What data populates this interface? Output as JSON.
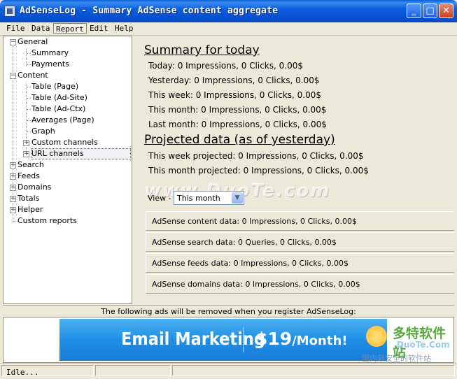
{
  "window": {
    "title": "AdSenseLog - Summary AdSense content aggregate"
  },
  "menu": [
    "File",
    "Data",
    "Report",
    "Edit",
    "Help"
  ],
  "menu_active": "Report",
  "tree": {
    "general": {
      "label": "General",
      "children": [
        "Summary",
        "Payments"
      ]
    },
    "content": {
      "label": "Content",
      "children": [
        "Table (Page)",
        "Table (Ad-Site)",
        "Table (Ad-Ctx)",
        "Averages (Page)",
        "Graph",
        "Custom channels",
        "URL channels"
      ]
    },
    "roots": [
      "Search",
      "Feeds",
      "Domains",
      "Totals",
      "Helper",
      "Custom reports"
    ],
    "selected": "URL channels"
  },
  "summary": {
    "title": "Summary for today",
    "rows": [
      "Today: 0 Impressions, 0 Clicks, 0.00$",
      "Yesterday: 0 Impressions, 0 Clicks, 0.00$",
      "This week: 0 Impressions, 0 Clicks, 0.00$",
      "This month: 0 Impressions, 0 Clicks, 0.00$",
      "Last month: 0 Impressions, 0 Clicks, 0.00$"
    ]
  },
  "projected": {
    "title": "Projected data (as of yesterday)",
    "rows": [
      "This week projected: 0 Impressions, 0 Clicks, 0.00$",
      "This month projected: 0 Impressions, 0 Clicks, 0.00$"
    ]
  },
  "watermark": "www.DuoTe.com",
  "view": {
    "label": "View -",
    "selected": "This month"
  },
  "data_panels": [
    "AdSense content data: 0 Impressions, 0 Clicks, 0.00$",
    "AdSense search data: 0 Queries, 0 Clicks, 0.00$",
    "AdSense feeds data: 0 Impressions, 0 Clicks, 0.00$",
    "AdSense domains data: 0 Impressions, 0 Clicks, 0.00$"
  ],
  "ads": {
    "notice": "The following ads will be removed when you register AdSenseLog:",
    "banner_left": "Email Marketing",
    "banner_price": "$19",
    "banner_suffix": "/Month!",
    "logo_line1": "多特软件站",
    "logo_line2": "DuoTe.Com",
    "logo_line3": "国内最安全的软件站"
  },
  "status": {
    "text": "Idle..."
  },
  "colors": {
    "titlebar": "#0a5fd8",
    "face": "#ece9d8",
    "banner": "#1f8fe6"
  }
}
